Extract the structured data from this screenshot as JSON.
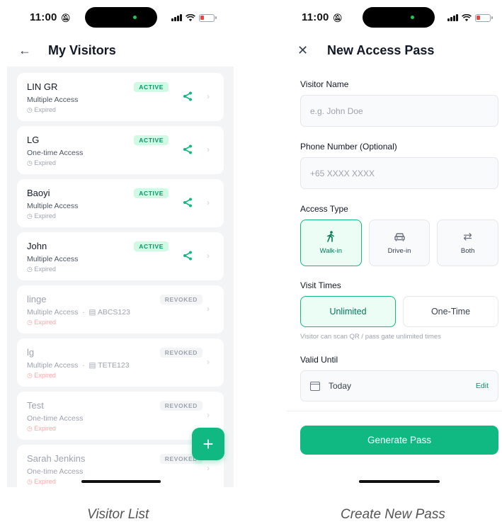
{
  "status_bar": {
    "time": "11:00"
  },
  "left_screen": {
    "title": "My Visitors",
    "visitors": [
      {
        "name": "LIN GR",
        "access": "Multiple Access",
        "plate": "",
        "expiry": "Expired",
        "badge": "ACTIVE",
        "state": "active"
      },
      {
        "name": "LG",
        "access": "One-time Access",
        "plate": "",
        "expiry": "Expired",
        "badge": "ACTIVE",
        "state": "active"
      },
      {
        "name": "Baoyi",
        "access": "Multiple Access",
        "plate": "",
        "expiry": "Expired",
        "badge": "ACTIVE",
        "state": "active"
      },
      {
        "name": "John",
        "access": "Multiple Access",
        "plate": "",
        "expiry": "Expired",
        "badge": "ACTIVE",
        "state": "active"
      },
      {
        "name": "linge",
        "access": "Multiple Access",
        "plate": "ABCS123",
        "expiry": "Expired",
        "badge": "REVOKED",
        "state": "revoked"
      },
      {
        "name": "lg",
        "access": "Multiple Access",
        "plate": "TETE123",
        "expiry": "Expired",
        "badge": "REVOKED",
        "state": "revoked"
      },
      {
        "name": "Test",
        "access": "One-time Access",
        "plate": "",
        "expiry": "Expired",
        "badge": "REVOKED",
        "state": "revoked"
      },
      {
        "name": "Sarah Jenkins",
        "access": "One-time Access",
        "plate": "",
        "expiry": "Expired",
        "badge": "REVOKED",
        "state": "revoked"
      }
    ],
    "fab_label": "+",
    "caption": "Visitor List"
  },
  "right_screen": {
    "title": "New Access Pass",
    "visitor_name": {
      "label": "Visitor Name",
      "placeholder": "e.g. John Doe"
    },
    "phone": {
      "label": "Phone Number (Optional)",
      "placeholder": "+65 XXXX XXXX"
    },
    "access_type": {
      "label": "Access Type",
      "options": [
        {
          "label": "Walk-in",
          "icon": "walking-person-icon",
          "selected": true
        },
        {
          "label": "Drive-in",
          "icon": "car-icon",
          "selected": false
        },
        {
          "label": "Both",
          "icon": "swap-arrows-icon",
          "selected": false
        }
      ]
    },
    "visit_times": {
      "label": "Visit Times",
      "options": [
        {
          "label": "Unlimited",
          "selected": true
        },
        {
          "label": "One-Time",
          "selected": false
        }
      ],
      "hint": "Visitor can scan QR / pass gate unlimited times"
    },
    "valid_until": {
      "label": "Valid Until",
      "value": "Today",
      "edit_label": "Edit"
    },
    "generate_label": "Generate Pass",
    "caption": "Create New Pass"
  },
  "colors": {
    "accent": "#10b981",
    "accent_dark": "#047857",
    "active_badge_bg": "#d1fae5",
    "expired_red": "#fca5a5"
  }
}
